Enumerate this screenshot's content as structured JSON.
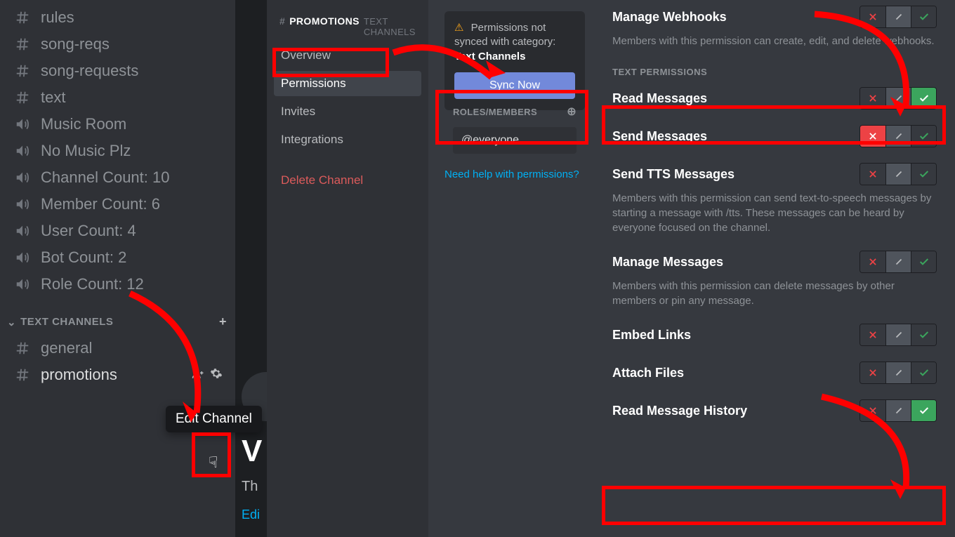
{
  "channels": {
    "top": [
      {
        "icon": "hash",
        "label": "rules"
      },
      {
        "icon": "hash",
        "label": "song-reqs"
      },
      {
        "icon": "hash",
        "label": "song-requests"
      },
      {
        "icon": "hash",
        "label": "text"
      },
      {
        "icon": "speaker",
        "label": "Music Room"
      },
      {
        "icon": "speaker",
        "label": "No Music Plz"
      },
      {
        "icon": "speaker",
        "label": "Channel Count: 10"
      },
      {
        "icon": "speaker",
        "label": "Member Count: 6"
      },
      {
        "icon": "speaker",
        "label": "User Count: 4"
      },
      {
        "icon": "speaker",
        "label": "Bot Count: 2"
      },
      {
        "icon": "speaker",
        "label": "Role Count: 12"
      }
    ],
    "category_label": "TEXT CHANNELS",
    "category": [
      {
        "icon": "hash",
        "label": "general",
        "selected": false
      },
      {
        "icon": "hash",
        "label": "promotions",
        "selected": true
      }
    ]
  },
  "tooltip": {
    "edit_channel": "Edit Channel"
  },
  "welcome": {
    "big": "V",
    "sub": "Th",
    "link": "Edi"
  },
  "settings_nav": {
    "channel_hash": "#",
    "channel_name": "PROMOTIONS",
    "section_suffix": "TEXT CHANNELS",
    "items": [
      "Overview",
      "Permissions",
      "Invites",
      "Integrations"
    ],
    "delete": "Delete Channel",
    "selected_index": 1
  },
  "sync": {
    "warn": "Permissions not synced with category:",
    "category": "Text Channels",
    "button": "Sync Now"
  },
  "roles": {
    "header": "ROLES/MEMBERS",
    "items": [
      "@everyone"
    ]
  },
  "help_link": "Need help with permissions?",
  "perm_section_header": "TEXT PERMISSIONS",
  "permissions": [
    {
      "key": "manage_webhooks",
      "title": "Manage Webhooks",
      "desc": "Members with this permission can create, edit, and delete webhooks.",
      "state": "neutral"
    },
    {
      "key": "read_messages",
      "title": "Read Messages",
      "desc": "",
      "state": "allow",
      "section_before": true
    },
    {
      "key": "send_messages",
      "title": "Send Messages",
      "desc": "",
      "state": "deny"
    },
    {
      "key": "send_tts",
      "title": "Send TTS Messages",
      "desc": "Members with this permission can send text-to-speech messages by starting a message with /tts. These messages can be heard by everyone focused on the channel.",
      "state": "neutral"
    },
    {
      "key": "manage_messages",
      "title": "Manage Messages",
      "desc": "Members with this permission can delete messages by other members or pin any message.",
      "state": "neutral"
    },
    {
      "key": "embed_links",
      "title": "Embed Links",
      "desc": "",
      "state": "neutral"
    },
    {
      "key": "attach_files",
      "title": "Attach Files",
      "desc": "",
      "state": "neutral"
    },
    {
      "key": "read_history",
      "title": "Read Message History",
      "desc": "",
      "state": "allow"
    }
  ]
}
